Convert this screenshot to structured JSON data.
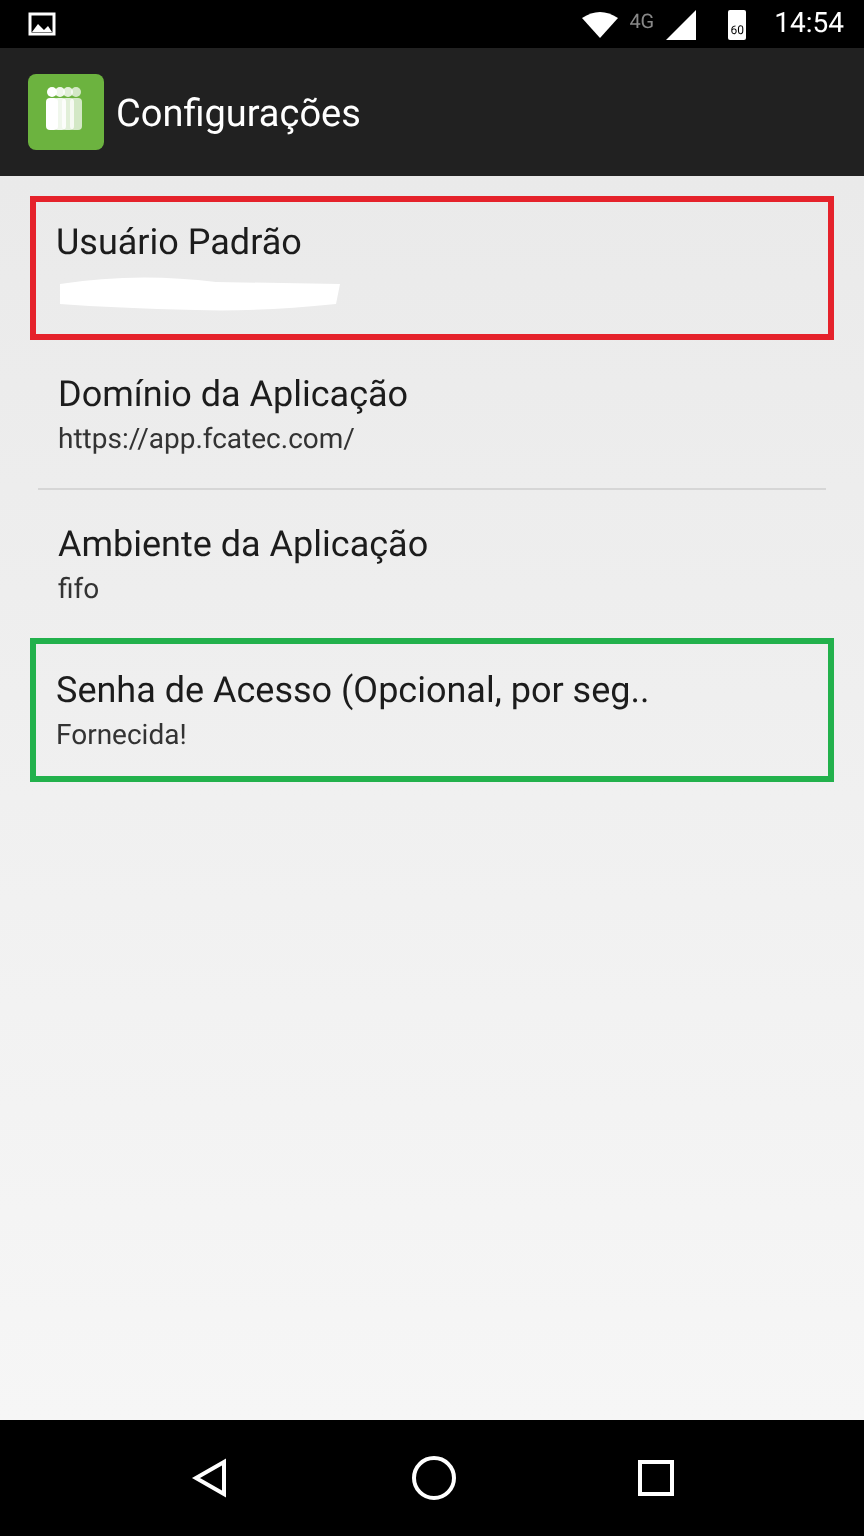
{
  "status_bar": {
    "network": "4G",
    "battery": "60",
    "time": "14:54"
  },
  "app_bar": {
    "title": "Configurações"
  },
  "settings": [
    {
      "title": "Usuário Padrão",
      "kind": "redacted",
      "color": "#e5222b",
      "divider": false
    },
    {
      "title": "Domínio da Aplicação",
      "summary": "https://app.fcatec.com/",
      "kind": "text",
      "divider": true
    },
    {
      "title": "Ambiente da Aplicação",
      "summary": "fifo",
      "kind": "text",
      "divider": false
    },
    {
      "title": "Senha de Acesso (Opcional, por seg..",
      "summary": "Fornecida!",
      "kind": "text",
      "color": "#22b14c",
      "divider": false
    }
  ]
}
